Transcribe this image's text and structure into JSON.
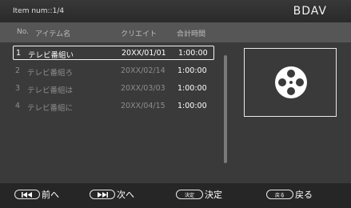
{
  "header": {
    "item_num": "Item num::1/4",
    "mode": "BDAV"
  },
  "columns": {
    "no": "No.",
    "name": "アイテム名",
    "created": "クリエイト",
    "total_time": "合計時間"
  },
  "rows": [
    {
      "no": "1",
      "name": "テレビ番組い",
      "created": "20XX/01/01",
      "total_time": "1:00:00",
      "selected": true
    },
    {
      "no": "2",
      "name": "テレビ番組ろ",
      "created": "20XX/02/14",
      "total_time": "1:00:00",
      "selected": false
    },
    {
      "no": "3",
      "name": "テレビ番組は",
      "created": "20XX/03/03",
      "total_time": "1:00:00",
      "selected": false
    },
    {
      "no": "4",
      "name": "テレビ番組に",
      "created": "20XX/04/15",
      "total_time": "1:00:00",
      "selected": false
    }
  ],
  "thumbnail": {
    "icon": "film-reel-icon"
  },
  "footer": {
    "prev_label": "前へ",
    "next_label": "次へ",
    "ok_key": "決定",
    "ok_label": "決定",
    "back_key": "戻る",
    "back_label": "戻る"
  }
}
